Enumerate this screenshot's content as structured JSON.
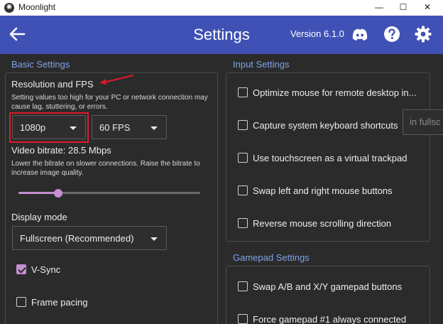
{
  "window": {
    "title": "Moonlight",
    "minimize": "—",
    "maximize": "☐",
    "close": "✕"
  },
  "header": {
    "title": "Settings",
    "version": "Version 6.1.0"
  },
  "basic": {
    "section_title": "Basic Settings",
    "res_fps_title": "Resolution and FPS",
    "res_fps_desc_1": "Setting values too high for your PC or network connection may",
    "res_fps_desc_2": "cause lag, stuttering, or errors.",
    "resolution_value": "1080p",
    "fps_value": "60 FPS",
    "bitrate_label": "Video bitrate: 28.5 Mbps",
    "bitrate_desc_1": "Lower the bitrate on slower connections. Raise the bitrate to",
    "bitrate_desc_2": "increase image quality.",
    "bitrate_fraction": 0.22,
    "display_mode_label": "Display mode",
    "display_mode_value": "Fullscreen (Recommended)",
    "vsync_label": "V-Sync",
    "vsync_checked": true,
    "frame_pacing_label": "Frame pacing",
    "frame_pacing_checked": false
  },
  "input": {
    "section_title": "Input Settings",
    "items": [
      {
        "label": "Optimize mouse for remote desktop in...",
        "checked": false
      },
      {
        "label": "Capture system keyboard shortcuts",
        "checked": false
      },
      {
        "label": "Use touchscreen as a virtual trackpad",
        "checked": false
      },
      {
        "label": "Swap left and right mouse buttons",
        "checked": false
      },
      {
        "label": "Reverse mouse scrolling direction",
        "checked": false
      }
    ],
    "shortcut_mode_partial": "in fullsc"
  },
  "gamepad": {
    "section_title": "Gamepad Settings",
    "items": [
      {
        "label": "Swap A/B and X/Y gamepad buttons",
        "checked": false
      },
      {
        "label": "Force gamepad #1 always connected",
        "checked": false
      }
    ]
  },
  "colors": {
    "accent": "#c58fd0",
    "header": "#3f51b5",
    "section_title": "#7da3e8",
    "annotation": "#e0192a"
  }
}
